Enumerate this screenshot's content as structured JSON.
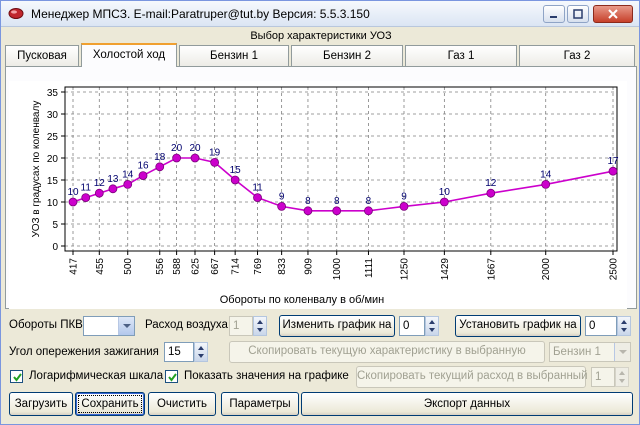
{
  "window": {
    "title": "Менеджер МПСЗ. E-mail:Paratruper@tut.by  Версия: 5.5.3.150",
    "caption": "Выбор характеристики УОЗ"
  },
  "tabs": [
    {
      "label": "Пусковая",
      "active": false
    },
    {
      "label": "Холостой ход",
      "active": true
    },
    {
      "label": "Бензин 1",
      "active": false
    },
    {
      "label": "Бензин 2",
      "active": false
    },
    {
      "label": "Газ 1",
      "active": false
    },
    {
      "label": "Газ 2",
      "active": false
    }
  ],
  "chart_data": {
    "type": "line",
    "xlabel": "Обороты по коленвалу в об/мин",
    "ylabel": "УОЗ  в  градусах по коленвалу",
    "x_scale": "log",
    "xlim": [
      417,
      2500
    ],
    "ylim": [
      0,
      35
    ],
    "yticks": [
      0,
      5,
      10,
      15,
      20,
      25,
      30,
      35
    ],
    "x": [
      417,
      435,
      455,
      476,
      500,
      526,
      556,
      588,
      625,
      667,
      714,
      769,
      833,
      909,
      1000,
      1111,
      1250,
      1429,
      1667,
      2000,
      2500
    ],
    "xtick_labels": [
      "417",
      "455",
      "500",
      "556",
      "588",
      "625",
      "667",
      "714",
      "769",
      "833",
      "909",
      "1000",
      "1111",
      "1250",
      "1429",
      "1667",
      "2000",
      "2500"
    ],
    "xtick_values": [
      417,
      455,
      500,
      556,
      588,
      625,
      667,
      714,
      769,
      833,
      909,
      1000,
      1111,
      1250,
      1429,
      1667,
      2000,
      2500
    ],
    "series": [
      {
        "color": "#cc00cc",
        "values": [
          10,
          11,
          12,
          13,
          14,
          16,
          18,
          20,
          20,
          19,
          15,
          11,
          9,
          8,
          8,
          8,
          9,
          10,
          12,
          14,
          17
        ]
      }
    ],
    "point_labels": [
      "10",
      "11",
      "12",
      "13",
      "14",
      "16",
      "18",
      "20",
      "20",
      "19",
      "15",
      "11",
      "9",
      "8",
      "8",
      "8",
      "9",
      "10",
      "12",
      "14",
      "17"
    ],
    "grid": true,
    "legend": "none"
  },
  "controls": {
    "pkv_label": "Обороты ПКВ",
    "pkv_value": "",
    "air_label": "Расход воздуха",
    "air_value": "1",
    "change_button": "Изменить график на",
    "change_value": "0",
    "set_button": "Установить график на",
    "set_value": "0",
    "ignition_label": "Угол опережения зажигания",
    "ignition_value": "15",
    "copy_char_button": "Скопировать текущую характеристику  в выбранную",
    "copy_char_target": "Бензин 1",
    "log_scale_label": "Логарифмическая шкала",
    "show_values_label": "Показать значения на графике",
    "copy_flow_button": "Скопировать текущий расход в выбранный",
    "copy_flow_value": "1",
    "load_button": "Загрузить",
    "save_button": "Сохранить",
    "clear_button": "Очистить",
    "params_button": "Параметры",
    "export_button": "Экспорт данных"
  },
  "colors": {
    "series": "#cc00cc",
    "marker": "#cc00cc",
    "point_label": "#00006e",
    "grid": "#808080"
  }
}
